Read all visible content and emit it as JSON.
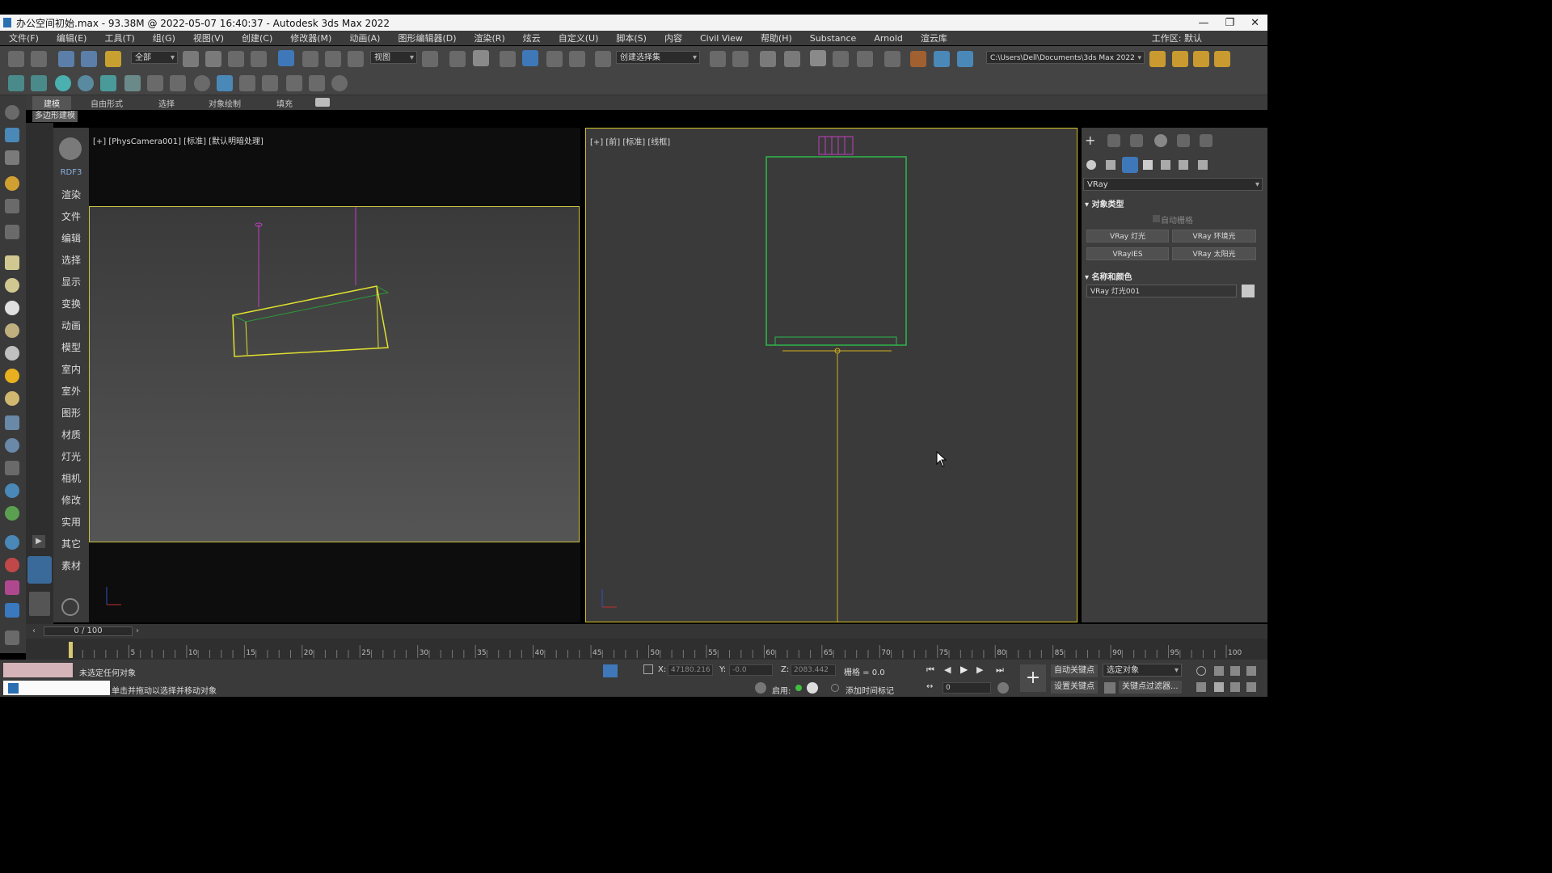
{
  "window": {
    "title": "办公空间初始.max - 93.38M @ 2022-05-07 16:40:37 - Autodesk 3ds Max 2022",
    "workspace_label": "工作区: 默认"
  },
  "menu": [
    "文件(F)",
    "编辑(E)",
    "工具(T)",
    "组(G)",
    "视图(V)",
    "创建(C)",
    "修改器(M)",
    "动画(A)",
    "图形编辑器(D)",
    "渲染(R)",
    "炫云",
    "自定义(U)",
    "脚本(S)",
    "内容",
    "Civil View",
    "帮助(H)",
    "Substance",
    "Arnold",
    "渲云库"
  ],
  "toolbar": {
    "selection_filter": "全部",
    "ref_coord": "视图",
    "named_selection": "创建选择集",
    "project_path": "C:\\Users\\Dell\\Documents\\3ds Max 2022"
  },
  "ribbon": {
    "tabs": [
      "建模",
      "自由形式",
      "选择",
      "对象绘制",
      "填充"
    ],
    "sub_label": "多边形建模"
  },
  "category_panel": {
    "header": "RDF3",
    "items": [
      "渲染",
      "文件",
      "编辑",
      "选择",
      "显示",
      "变换",
      "动画",
      "模型",
      "室内",
      "室外",
      "图形",
      "材质",
      "灯光",
      "相机",
      "修改",
      "实用",
      "其它",
      "素材"
    ]
  },
  "viewports": {
    "left_label": "[+] [PhysCamera001] [标准] [默认明暗处理]",
    "right_label": "[+] [前] [标准] [线框]"
  },
  "command_panel": {
    "renderer_dropdown": "VRay",
    "object_type_title": "对象类型",
    "autogrid_label": "自动栅格",
    "buttons": [
      "VRay 灯光",
      "VRay 环境光",
      "VRayIES",
      "VRay 太阳光"
    ],
    "name_color_title": "名称和颜色",
    "object_name": "VRay 灯光001"
  },
  "timeline": {
    "frame_display": "0 / 100",
    "ticks": [
      "0",
      "5",
      "10",
      "15",
      "20",
      "25",
      "30",
      "35",
      "40",
      "45",
      "50",
      "55",
      "60",
      "65",
      "70",
      "75",
      "80",
      "85",
      "90",
      "95",
      "100"
    ]
  },
  "status": {
    "selection_info": "未选定任何对象",
    "prompt": "单击并拖动以选择并移动对象",
    "x_label": "X:",
    "x_value": "47180.216",
    "y_label": "Y:",
    "y_value": "-0.0",
    "z_label": "Z:",
    "z_value": "2083.442",
    "grid_label": "栅格 = 0.0",
    "enable_label": "启用:",
    "add_time_tag": "添加时间标记",
    "auto_key": "自动关键点",
    "set_key": "设置关键点",
    "key_target": "选定对象",
    "key_filters": "关键点过滤器...",
    "frame_field": "0"
  }
}
